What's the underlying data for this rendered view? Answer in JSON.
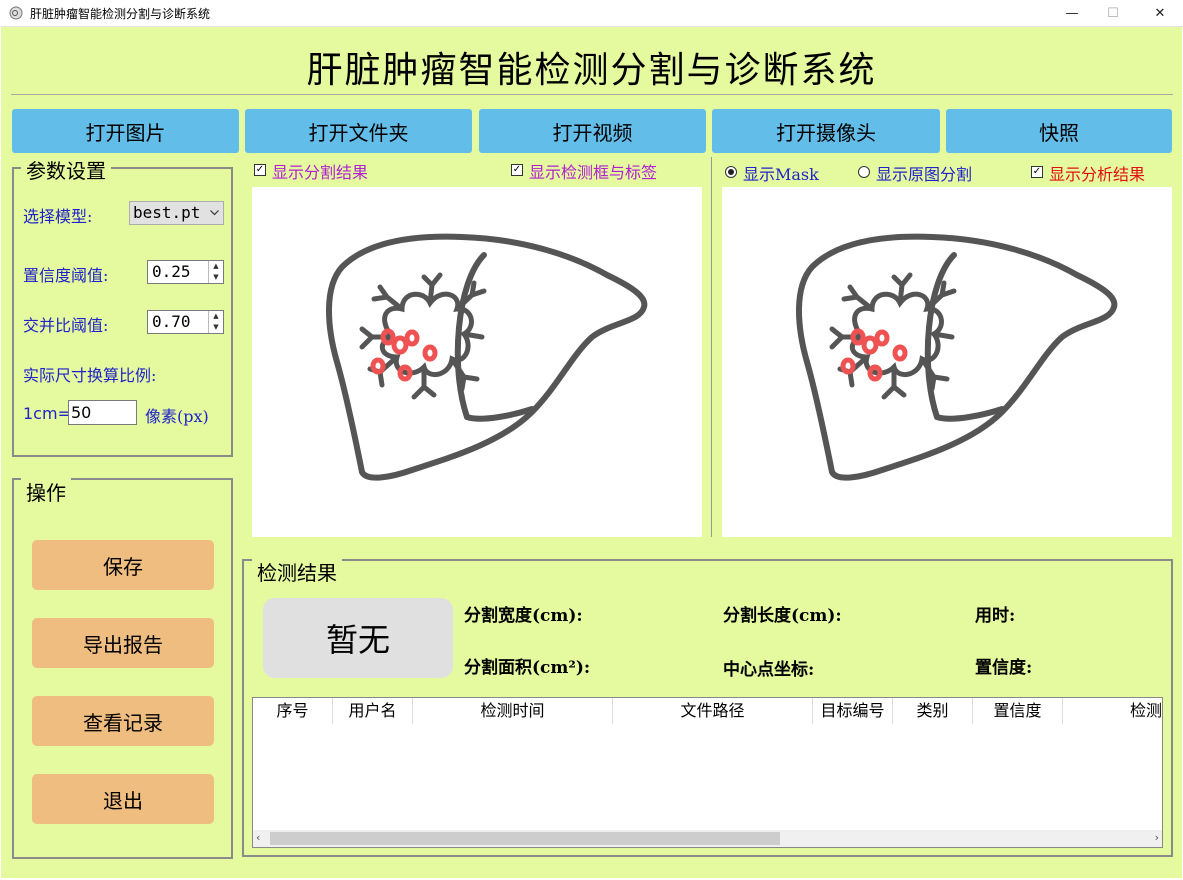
{
  "window": {
    "title": "肝脏肿瘤智能检测分割与诊断系统",
    "minimize": "—",
    "maximize": "☐",
    "close": "✕"
  },
  "app_title": "肝脏肿瘤智能检测分割与诊断系统",
  "toolbar": {
    "open_image": "打开图片",
    "open_folder": "打开文件夹",
    "open_video": "打开视频",
    "open_camera": "打开摄像头",
    "snapshot": "快照"
  },
  "params": {
    "group_title": "参数设置",
    "model_label": "选择模型:",
    "model_value": "best.pt",
    "conf_label": "置信度阈值:",
    "conf_value": "0.25",
    "iou_label": "交并比阈值:",
    "iou_value": "0.70",
    "scale_label": "实际尺寸换算比例:",
    "cm_label": "1cm=",
    "px_value": "50",
    "px_unit": "像素(px)"
  },
  "ops": {
    "group_title": "操作",
    "save": "保存",
    "export_report": "导出报告",
    "view_records": "查看记录",
    "exit": "退出"
  },
  "left_options": {
    "show_seg": "显示分割结果",
    "show_box": "显示检测框与标签",
    "show_seg_checked": true,
    "show_box_checked": true
  },
  "right_options": {
    "show_mask": "显示Mask",
    "show_orig_seg": "显示原图分割",
    "show_analysis": "显示分析结果",
    "mode": "mask",
    "show_analysis_checked": true
  },
  "results": {
    "group_title": "检测结果",
    "class_display": "暂无",
    "seg_width": "分割宽度(cm):",
    "seg_length": "分割长度(cm):",
    "time_used": "用时:",
    "seg_area": "分割面积(cm²):",
    "center": "中心点坐标:",
    "confidence": "置信度:"
  },
  "table": {
    "columns": [
      "序号",
      "用户名",
      "检测时间",
      "文件路径",
      "目标编号",
      "类别",
      "置信度",
      "检测"
    ],
    "rows": []
  },
  "colors": {
    "background": "#e5f99f",
    "toolbar_button": "#63bde9",
    "op_button": "#f0bd80",
    "label_blue": "#1f23c9",
    "option_purple": "#b020d0",
    "option_red": "#e01010",
    "liver_outline": "#555555",
    "tumor": "#ef5252"
  },
  "icons": {
    "app": "liver-app-icon",
    "checkbox": "checkbox-icon",
    "radio": "radio-icon",
    "dropdown": "chevron-down-icon"
  }
}
